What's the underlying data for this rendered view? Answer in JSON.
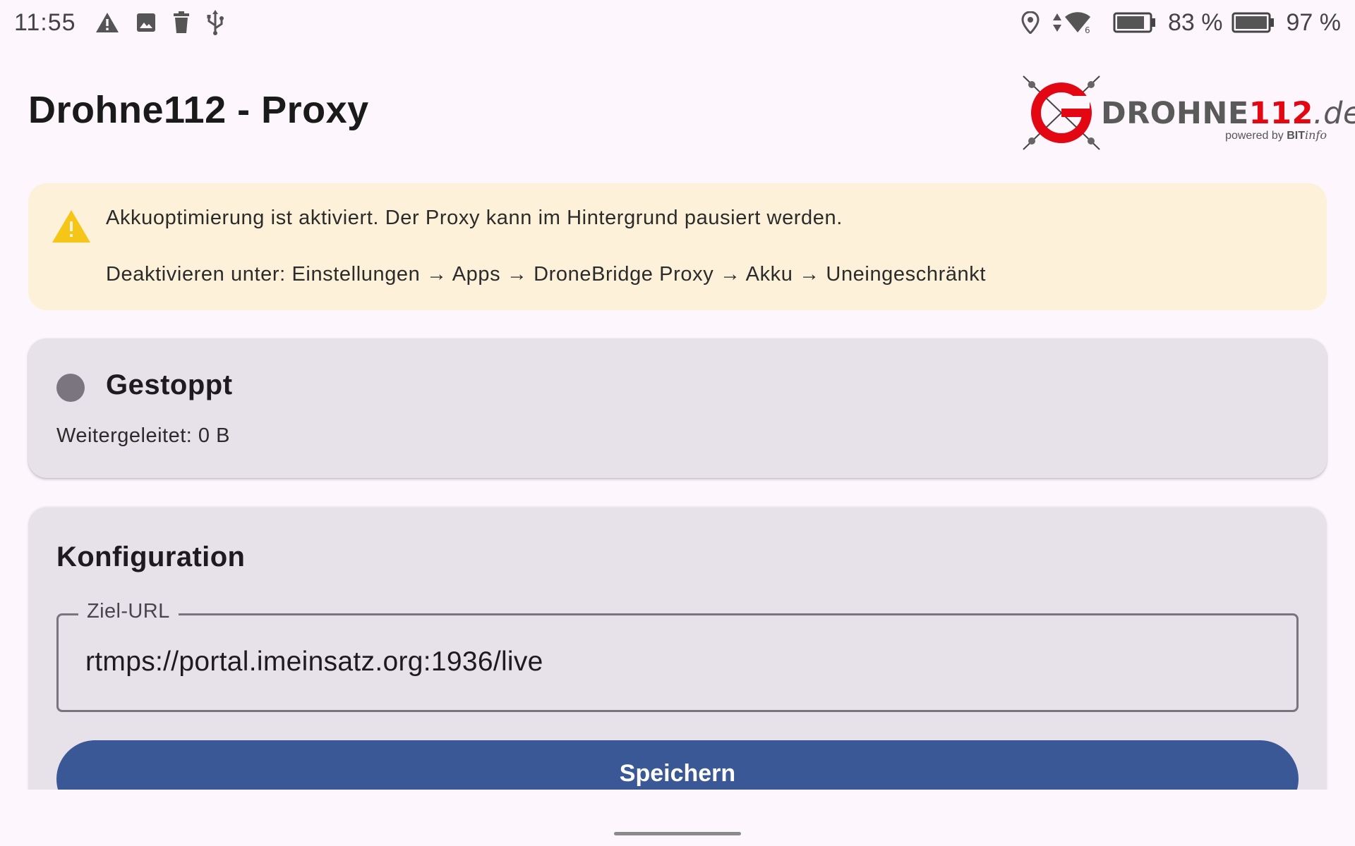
{
  "status_bar": {
    "time": "11:55",
    "left_icons": [
      "alert-icon",
      "image-icon",
      "trash-icon",
      "usb-icon"
    ],
    "right_icons": [
      "location-icon",
      "data-arrows-icon",
      "wifi-icon",
      "battery-icon"
    ],
    "battery_1": "83 %",
    "battery_2": "97 %"
  },
  "header": {
    "title": "Drohne112 - Proxy",
    "logo": {
      "word_a": "DROHNE",
      "word_b": "112",
      "word_c": ".de",
      "tagline_prefix": "powered by ",
      "tagline_brand": "BIT",
      "tagline_suffix": "info",
      "accent_color": "#e30613"
    }
  },
  "warning": {
    "icon": "warning-icon",
    "line1": "Akkuoptimierung ist aktiviert. Der Proxy kann im Hintergrund pausiert werden.",
    "line2": "Deaktivieren unter: Einstellungen → Apps → DroneBridge Proxy → Akku → Uneingeschränkt",
    "background": "#fdf2d9",
    "icon_color": "#f5c518"
  },
  "status": {
    "state": "Gestoppt",
    "indicator_color": "#7a757f",
    "forwarded": "Weitergeleitet: 0 B"
  },
  "config": {
    "title": "Konfiguration",
    "url_label": "Ziel-URL",
    "url_value": "rtmps://portal.imeinsatz.org:1936/live",
    "save_label": "Speichern",
    "button_color": "#3a5896"
  }
}
